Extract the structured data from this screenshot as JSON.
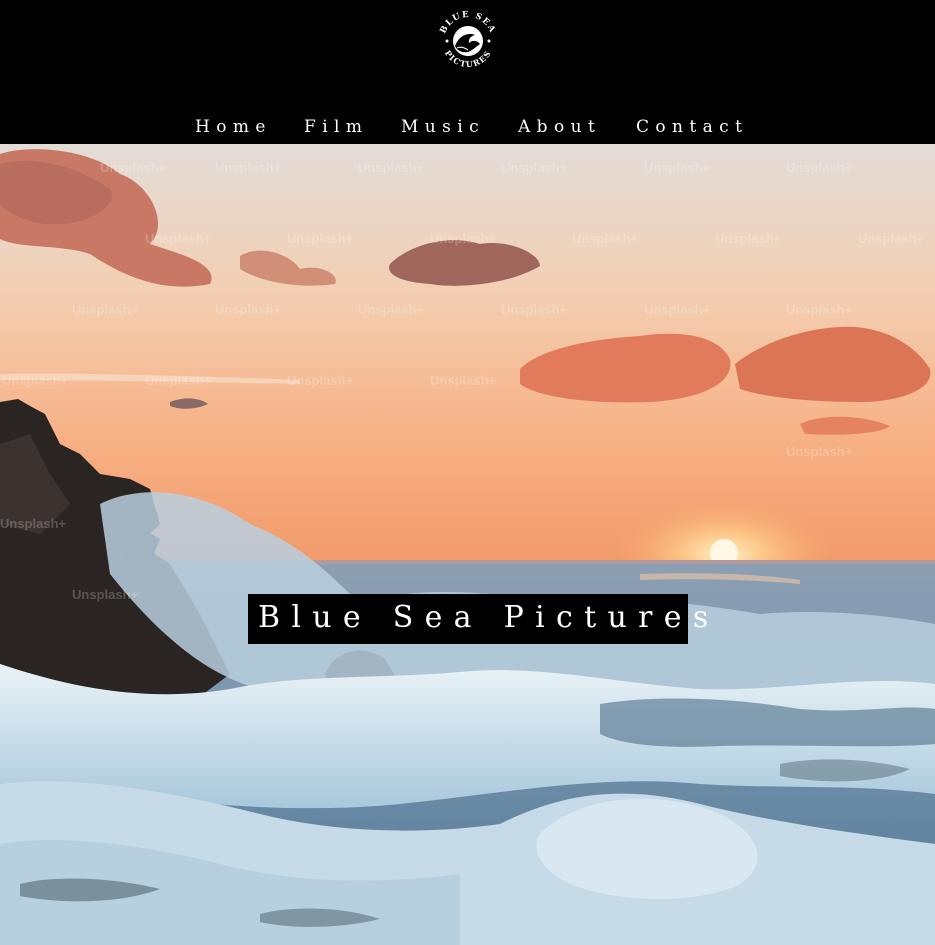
{
  "header": {
    "logo": {
      "arc_top_text": "BLUE SEA",
      "arc_bottom_text": "PICTURES"
    },
    "nav": [
      {
        "label": "Home"
      },
      {
        "label": "Film"
      },
      {
        "label": "Music"
      },
      {
        "label": "About"
      },
      {
        "label": "Contact"
      }
    ]
  },
  "hero": {
    "title": "Blue Sea Pictures",
    "watermark": "Unsplash+"
  },
  "colors": {
    "header_bg": "#000000",
    "nav_text": "#ffffff",
    "title_box_bg": "#000000",
    "sky_top": "#e6ddd6",
    "sky_horizon": "#f4a374",
    "sea": "#6f8ea8",
    "foam": "#cfe3ee"
  }
}
